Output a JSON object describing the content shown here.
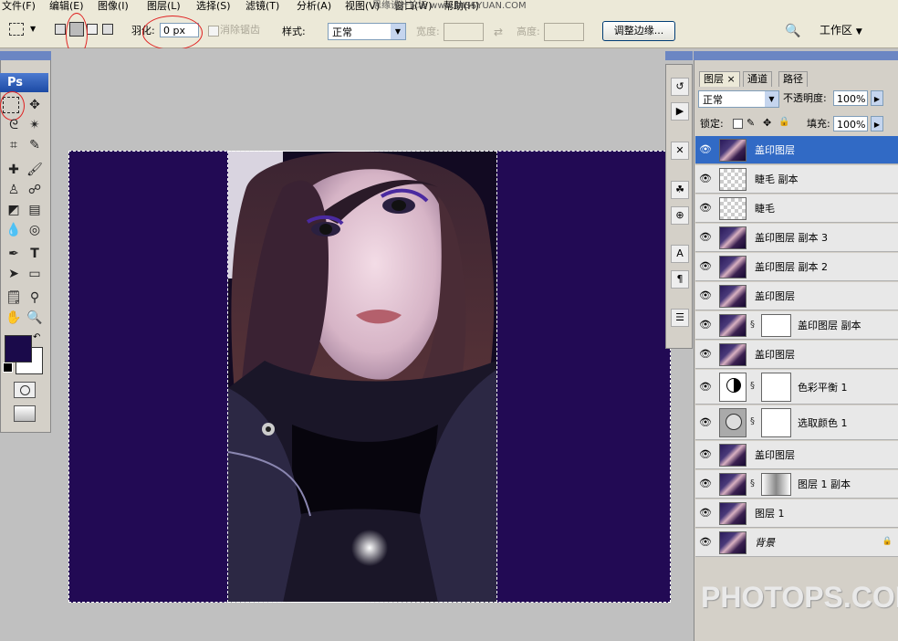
{
  "menubar": {
    "items": [
      "文件(F)",
      "编辑(E)",
      "图像(I)",
      "图层(L)",
      "选择(S)",
      "滤镜(T)",
      "分析(A)",
      "视图(V)",
      "窗口(W)",
      "帮助(H)"
    ],
    "watermark": "思缘设计论坛 www.MISSYUAN.COM"
  },
  "options": {
    "feather_label": "羽化:",
    "feather_value": "0 px",
    "antialias_label": "消除锯齿",
    "style_label": "样式:",
    "style_value": "正常",
    "width_label": "宽度:",
    "height_label": "高度:",
    "refine_edge_label": "调整边缘...",
    "workspace_label": "工作区"
  },
  "toolbox": {
    "logo": "Ps"
  },
  "layers_panel": {
    "tabs": [
      "图层",
      "通道",
      "路径"
    ],
    "blend_mode": "正常",
    "opacity_label": "不透明度:",
    "opacity_value": "100%",
    "lock_label": "锁定:",
    "fill_label": "填充:",
    "fill_value": "100%",
    "layers": [
      {
        "name": "盖印图层",
        "selected": true
      },
      {
        "name": "睫毛 副本"
      },
      {
        "name": "睫毛"
      },
      {
        "name": "盖印图层 副本 3"
      },
      {
        "name": "盖印图层 副本 2"
      },
      {
        "name": "盖印图层"
      },
      {
        "name": "盖印图层 副本"
      },
      {
        "name": "盖印图层"
      },
      {
        "name": "色彩平衡 1"
      },
      {
        "name": "选取颜色 1"
      },
      {
        "name": "盖印图层"
      },
      {
        "name": "图层 1 副本"
      },
      {
        "name": "图层 1"
      },
      {
        "name": "背景"
      }
    ]
  },
  "colors": {
    "canvas_bg": "#220a54",
    "selection_highlight": "#316ac5",
    "foreground_color": "#1a0a4a",
    "background_color": "#ffffff"
  },
  "branding": {
    "watermark": "PHOTOPS.COM"
  }
}
